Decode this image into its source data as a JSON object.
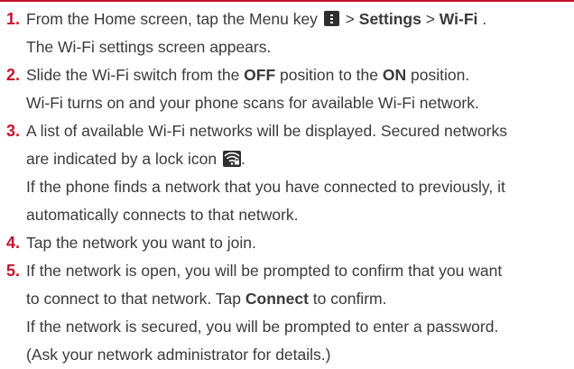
{
  "steps": [
    {
      "number": "1.",
      "line1": {
        "pre": "From the Home screen, tap the Menu key",
        "sep1": " > ",
        "settings": "Settings",
        "sep2": " > ",
        "wifi": "Wi-Fi",
        "end": "."
      },
      "line2": "The Wi-Fi settings screen appears."
    },
    {
      "number": "2.",
      "line1": {
        "pre": "Slide the Wi-Fi switch from the ",
        "off": "OFF",
        "mid": " position to the ",
        "on": "ON",
        "end": " position."
      },
      "line2": "Wi-Fi turns on and your phone scans for available Wi-Fi network."
    },
    {
      "number": "3.",
      "line1": "A list of available Wi-Fi networks will be displayed. Secured networks",
      "line2": {
        "pre": "are indicated by a lock icon",
        "end": "."
      },
      "line3": "If the phone finds a network that you have connected to previously, it",
      "line4": "automatically connects to that network."
    },
    {
      "number": "4.",
      "line1": "Tap the network you want to join."
    },
    {
      "number": "5.",
      "line1": "If the network is open, you will be prompted to confirm that you want",
      "line2": {
        "pre": "to connect to that network. Tap ",
        "connect": "Connect",
        "end": " to confirm."
      },
      "line3": "If the network is secured, you will be prompted to enter a password.",
      "line4": "(Ask your network administrator for details.)"
    }
  ],
  "icons": {
    "menu_key": "menu-key-icon",
    "lock": "wifi-lock-icon"
  },
  "colors": {
    "accent": "#c8102e",
    "text": "#3a3a3a",
    "icon_bg": "#2e2e2e"
  }
}
